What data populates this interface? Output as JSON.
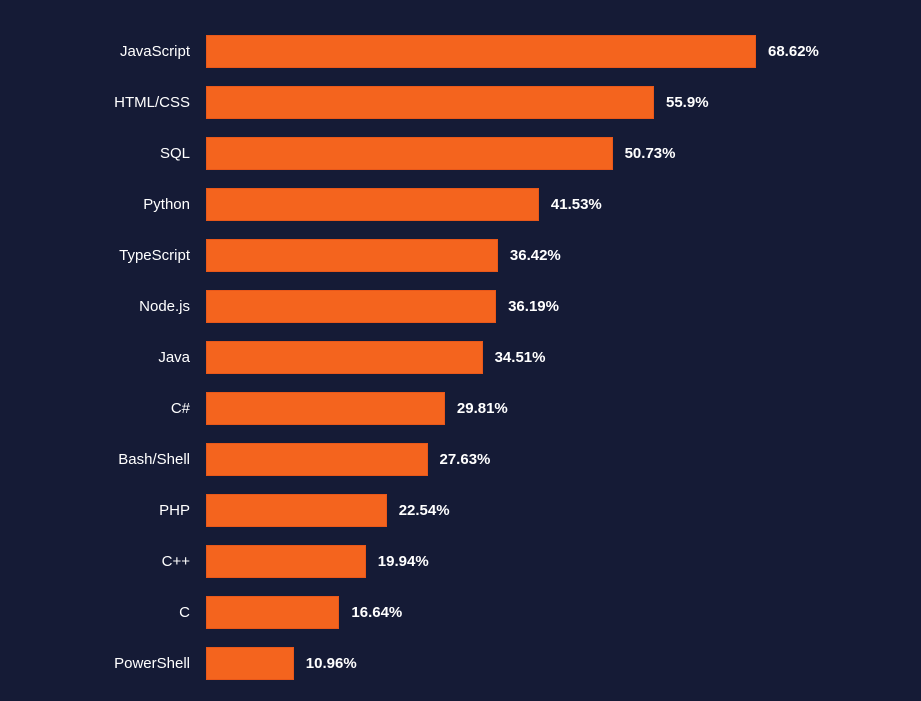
{
  "chart_data": {
    "type": "bar",
    "title": "",
    "xlabel": "",
    "ylabel": "",
    "xlim": [
      0,
      70
    ],
    "categories": [
      "JavaScript",
      "HTML/CSS",
      "SQL",
      "Python",
      "TypeScript",
      "Node.js",
      "Java",
      "C#",
      "Bash/Shell",
      "PHP",
      "C++",
      "C",
      "PowerShell"
    ],
    "values": [
      68.62,
      55.9,
      50.73,
      41.53,
      36.42,
      36.19,
      34.51,
      29.81,
      27.63,
      22.54,
      19.94,
      16.64,
      10.96
    ],
    "value_labels": [
      "68.62%",
      "55.9%",
      "50.73%",
      "41.53%",
      "36.42%",
      "36.19%",
      "34.51%",
      "29.81%",
      "27.63%",
      "22.54%",
      "19.94%",
      "16.64%",
      "10.96%"
    ],
    "bar_color": "#f4641e",
    "background_color": "#151b36"
  }
}
